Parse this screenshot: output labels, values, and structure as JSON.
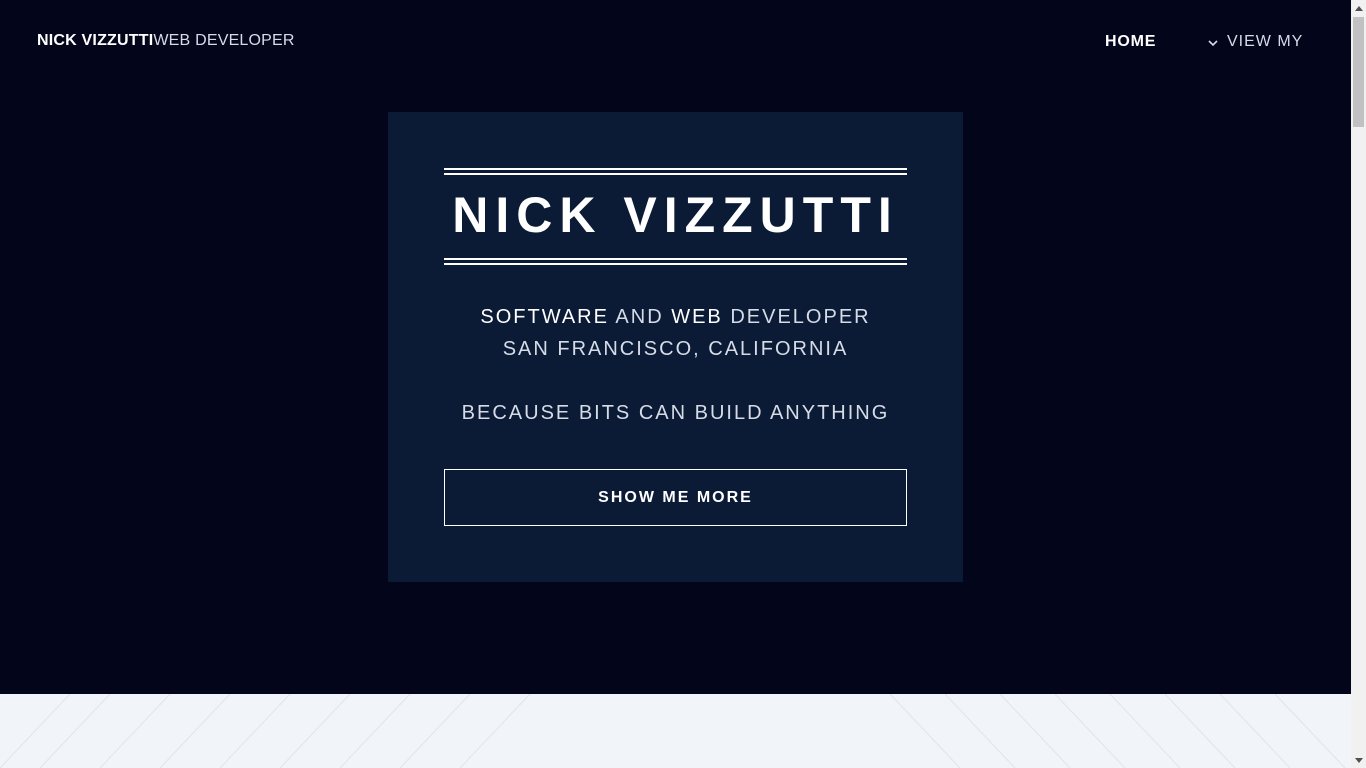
{
  "header": {
    "brand_name": "NICK VIZZUTTI",
    "brand_role": "WEB DEVELOPER",
    "nav": {
      "home_label": "HOME",
      "view_label": "VIEW MY"
    }
  },
  "hero_card": {
    "title": "NICK VIZZUTTI",
    "line1": {
      "software": "SOFTWARE",
      "and": "AND",
      "web": "WEB",
      "developer": "DEVELOPER"
    },
    "line2": "SAN FRANCISCO, CALIFORNIA",
    "line3": "BECAUSE BITS CAN BUILD ANYTHING",
    "cta_label": "SHOW ME MORE"
  },
  "icons": {
    "nav_dropdown": "chevron-down-icon",
    "scroll_up": "triangle-up-icon",
    "scroll_down": "triangle-down-icon"
  },
  "colors": {
    "background": "#03051a",
    "card": "#0c1b35",
    "lower_section": "#f1f4f9",
    "text": "#ffffff"
  }
}
